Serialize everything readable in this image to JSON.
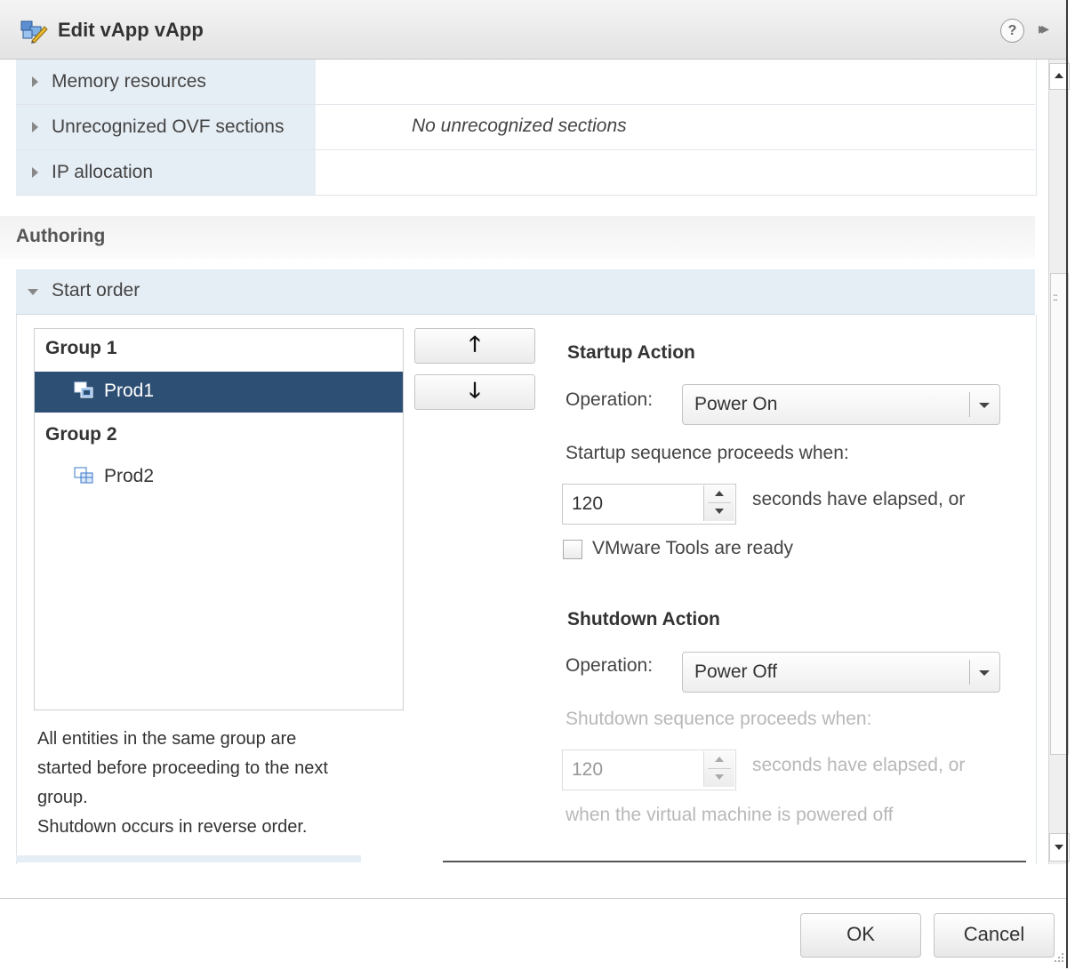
{
  "window": {
    "title": "Edit vApp vApp",
    "help_icon": "?",
    "expand_icon": "▸▸"
  },
  "properties": [
    {
      "label": "Memory resources",
      "value": ""
    },
    {
      "label": "Unrecognized OVF sections",
      "value": "No unrecognized sections"
    },
    {
      "label": "IP allocation",
      "value": ""
    }
  ],
  "authoring": {
    "label": "Authoring",
    "start_order": {
      "label": "Start order",
      "groups": [
        {
          "name": "Group 1",
          "items": [
            {
              "name": "Prod1",
              "selected": true
            }
          ]
        },
        {
          "name": "Group 2",
          "items": [
            {
              "name": "Prod2",
              "selected": false
            }
          ]
        }
      ],
      "move_up": "🡑",
      "move_down": "🡓",
      "note_lines": [
        "All entities in the same group are",
        "started before proceeding to the next",
        "group.",
        "Shutdown occurs in reverse order."
      ],
      "startup": {
        "title": "Startup Action",
        "operation_label": "Operation:",
        "operation_value": "Power On",
        "sequence_label": "Startup sequence proceeds when:",
        "seconds_value": "120",
        "seconds_label": "seconds have elapsed, or",
        "tools_label": "VMware Tools are ready",
        "tools_checked": false
      },
      "shutdown": {
        "title": "Shutdown Action",
        "operation_label": "Operation:",
        "operation_value": "Power Off",
        "sequence_label": "Shutdown sequence proceeds when:",
        "seconds_value": "120",
        "seconds_label": "seconds have elapsed, or",
        "powered_off_label": "when the virtual machine is powered off"
      }
    }
  },
  "footer": {
    "ok_label": "OK",
    "cancel_label": "Cancel"
  },
  "colors": {
    "selection": "#2e4f74",
    "section_header": "#e6eef5"
  }
}
